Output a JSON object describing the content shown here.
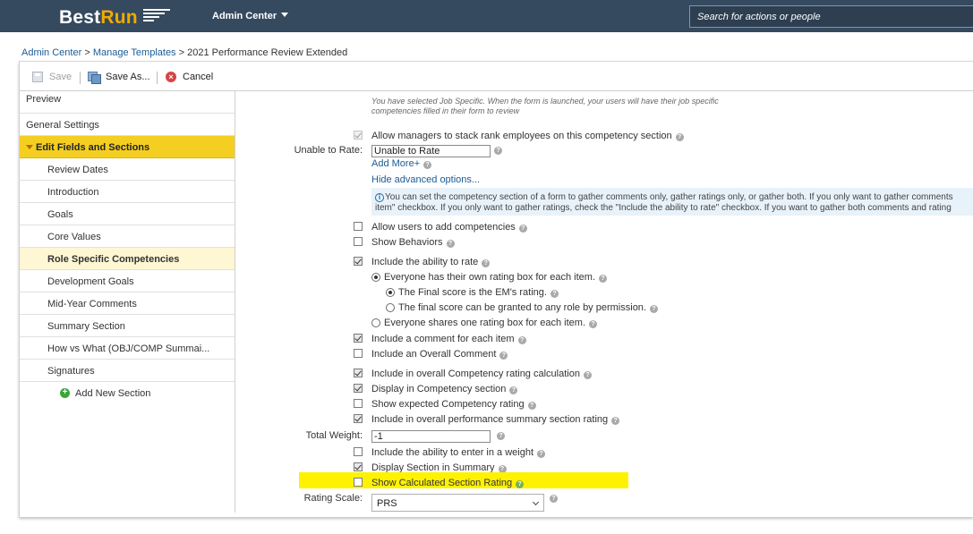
{
  "header": {
    "logo_best": "Best",
    "logo_run": "Run",
    "admin_menu": "Admin Center",
    "search_placeholder": "Search for actions or people"
  },
  "breadcrumb": {
    "admin_center": "Admin Center",
    "sep1": " > ",
    "manage_templates": "Manage Templates",
    "sep2": " > ",
    "current": "2021 Performance Review Extended"
  },
  "toolbar": {
    "save": "Save",
    "save_as": "Save As...",
    "cancel": "Cancel"
  },
  "nav": {
    "preview": "Preview",
    "general_settings": "General Settings",
    "edit_fields": "Edit Fields and Sections",
    "items": [
      "Review Dates",
      "Introduction",
      "Goals",
      "Core Values",
      "Role Specific Competencies",
      "Development Goals",
      "Mid-Year Comments",
      "Summary Section",
      "How vs What (OBJ/COMP Summai...",
      "Signatures"
    ],
    "add_section": "Add New Section"
  },
  "main": {
    "note": "You have selected Job Specific. When the form is launched, your users will have their job specific competencies filled in their form to review",
    "stack_rank": "Allow managers to stack rank employees on this competency section",
    "unable_label": "Unable to Rate:",
    "unable_value": "Unable to Rate",
    "add_more": "Add More+",
    "hide_advanced": "Hide advanced options...",
    "info_line1": "You can set the competency section of a form to gather comments only, gather ratings only, or gather both. If you only want to gather comments",
    "info_line2": "item\" checkbox. If you only want to gather ratings, check the \"Include the ability to rate\" checkbox. If you want to gather both comments and rating",
    "allow_add": "Allow users to add competencies",
    "show_behaviors": "Show Behaviors",
    "include_rate": "Include the ability to rate",
    "everyone_own": "Everyone has their own rating box for each item.",
    "final_em": "The Final score is the EM's rating.",
    "final_any": "The final score can be granted to any role by permission.",
    "everyone_shares": "Everyone shares one rating box for each item.",
    "include_comment": "Include a comment for each item",
    "include_overall_comment": "Include an Overall Comment",
    "include_overall_calc": "Include in overall Competency rating calculation",
    "display_in_section": "Display in Competency section",
    "show_expected": "Show expected Competency rating",
    "include_summary": "Include in overall performance summary section rating",
    "total_weight_label": "Total Weight:",
    "total_weight_value": "-1",
    "include_weight": "Include the ability to enter in a weight",
    "display_summary": "Display Section in Summary",
    "show_calculated": "Show Calculated Section Rating",
    "rating_scale_label": "Rating Scale:",
    "rating_scale_value": "PRS"
  },
  "colors": {
    "header_bg": "#354a5f",
    "section_highlight": "#f5ce22",
    "active_item": "#fdf7d3",
    "yellow_highlight": "#fff200",
    "link": "#1a5b96"
  }
}
